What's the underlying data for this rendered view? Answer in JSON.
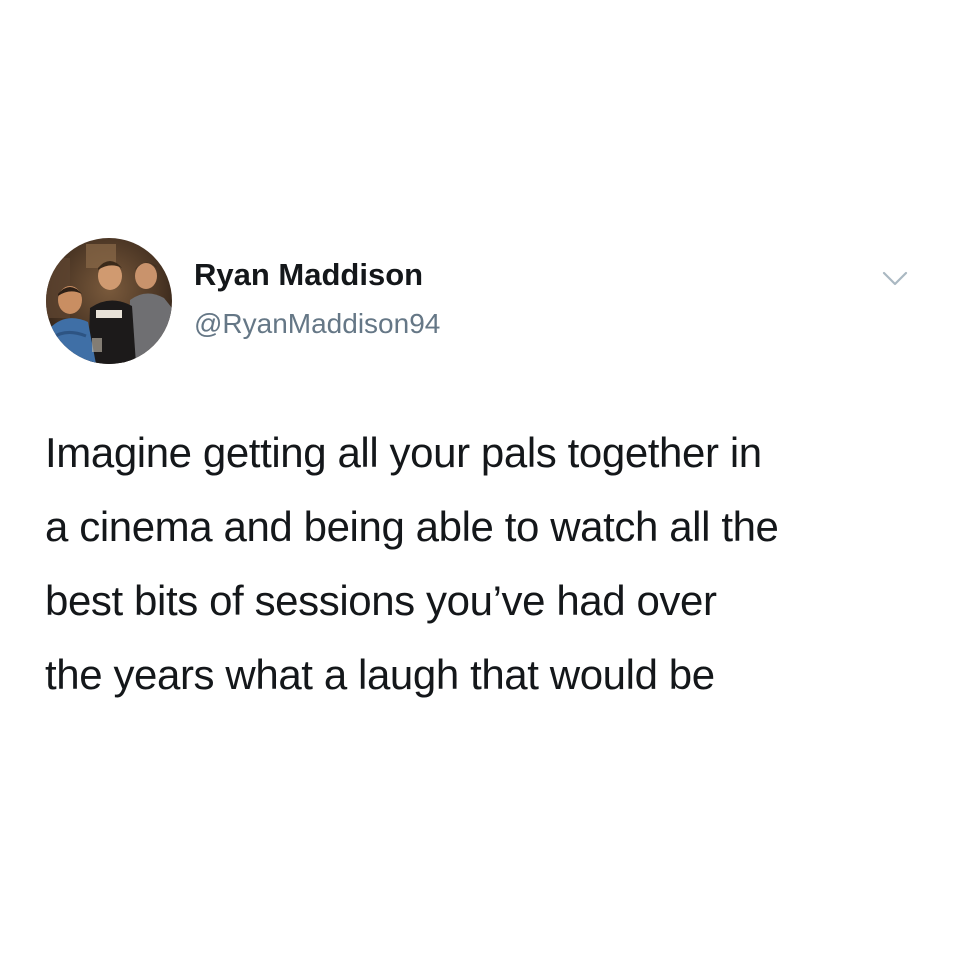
{
  "author": {
    "display_name": "Ryan Maddison",
    "handle": "@RyanMaddison94",
    "avatar_icon": "profile-photo"
  },
  "menu": {
    "icon": "chevron-down-icon"
  },
  "tweet": {
    "text": "Imagine getting all your pals together in\na cinema and being able to watch all the\nbest bits of sessions you’ve had over\nthe years what a laugh that would be"
  },
  "colors": {
    "text_primary": "#14171a",
    "text_secondary": "#657786",
    "chevron": "#aab8c2",
    "background": "#ffffff"
  }
}
